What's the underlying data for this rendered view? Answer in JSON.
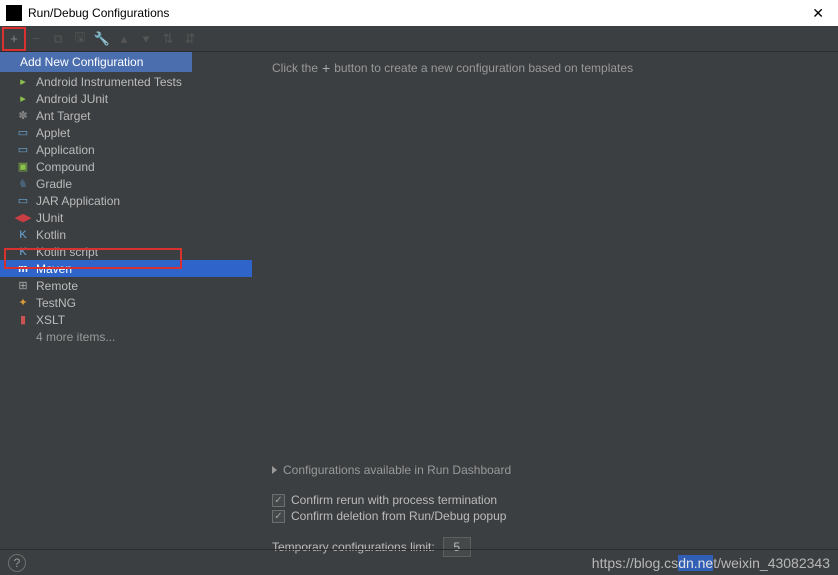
{
  "titlebar": {
    "title": "Run/Debug Configurations"
  },
  "dropdown": {
    "header": "Add New Configuration"
  },
  "configs": [
    {
      "label": "Android Instrumented Tests",
      "iconClass": "ic-android",
      "glyph": "▸"
    },
    {
      "label": "Android JUnit",
      "iconClass": "ic-android",
      "glyph": "▸"
    },
    {
      "label": "Ant Target",
      "iconClass": "ic-ant",
      "glyph": "✽"
    },
    {
      "label": "Applet",
      "iconClass": "ic-applet",
      "glyph": "▭"
    },
    {
      "label": "Application",
      "iconClass": "ic-app",
      "glyph": "▭"
    },
    {
      "label": "Compound",
      "iconClass": "ic-compound",
      "glyph": "▣"
    },
    {
      "label": "Gradle",
      "iconClass": "ic-gradle",
      "glyph": "♞"
    },
    {
      "label": "JAR Application",
      "iconClass": "ic-jar",
      "glyph": "▭"
    },
    {
      "label": "JUnit",
      "iconClass": "ic-junit",
      "glyph": "◀▶"
    },
    {
      "label": "Kotlin",
      "iconClass": "ic-kotlin",
      "glyph": "K"
    },
    {
      "label": "Kotlin script",
      "iconClass": "ic-kotlin",
      "glyph": "K"
    },
    {
      "label": "Maven",
      "iconClass": "ic-maven",
      "glyph": "m",
      "selected": true
    },
    {
      "label": "Remote",
      "iconClass": "ic-remote",
      "glyph": "⊞"
    },
    {
      "label": "TestNG",
      "iconClass": "ic-testng",
      "glyph": "✦"
    },
    {
      "label": "XSLT",
      "iconClass": "ic-xslt",
      "glyph": "▮"
    }
  ],
  "moreItems": "4 more items...",
  "content": {
    "hintPrefix": "Click the",
    "hintSuffix": "button to create a new configuration based on templates",
    "dashboard": "Configurations available in Run Dashboard",
    "check1": "Confirm rerun with process termination",
    "check2": "Confirm deletion from Run/Debug popup",
    "limitLabel": "Temporary configurations limit:",
    "limitValue": "5"
  },
  "watermark": {
    "prefix": "https://blog.cs",
    "sel": "dn.ne",
    "suffix": "t/weixin_43082343"
  }
}
